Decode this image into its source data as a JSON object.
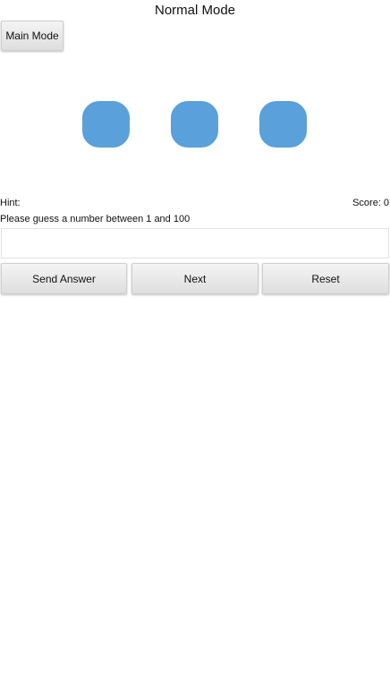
{
  "header": {
    "title": "Normal Mode"
  },
  "mode_button": {
    "label": "Main Mode"
  },
  "tiles": {
    "count": 3,
    "color": "#5aa0da"
  },
  "status": {
    "hint_label": "Hint:",
    "hint_value": "",
    "score_label": "Score:",
    "score_value": "0"
  },
  "prompt": {
    "text": "Please guess a number between 1 and 100"
  },
  "answer_input": {
    "value": "",
    "placeholder": ""
  },
  "actions": {
    "send_label": "Send Answer",
    "next_label": "Next",
    "reset_label": "Reset"
  }
}
